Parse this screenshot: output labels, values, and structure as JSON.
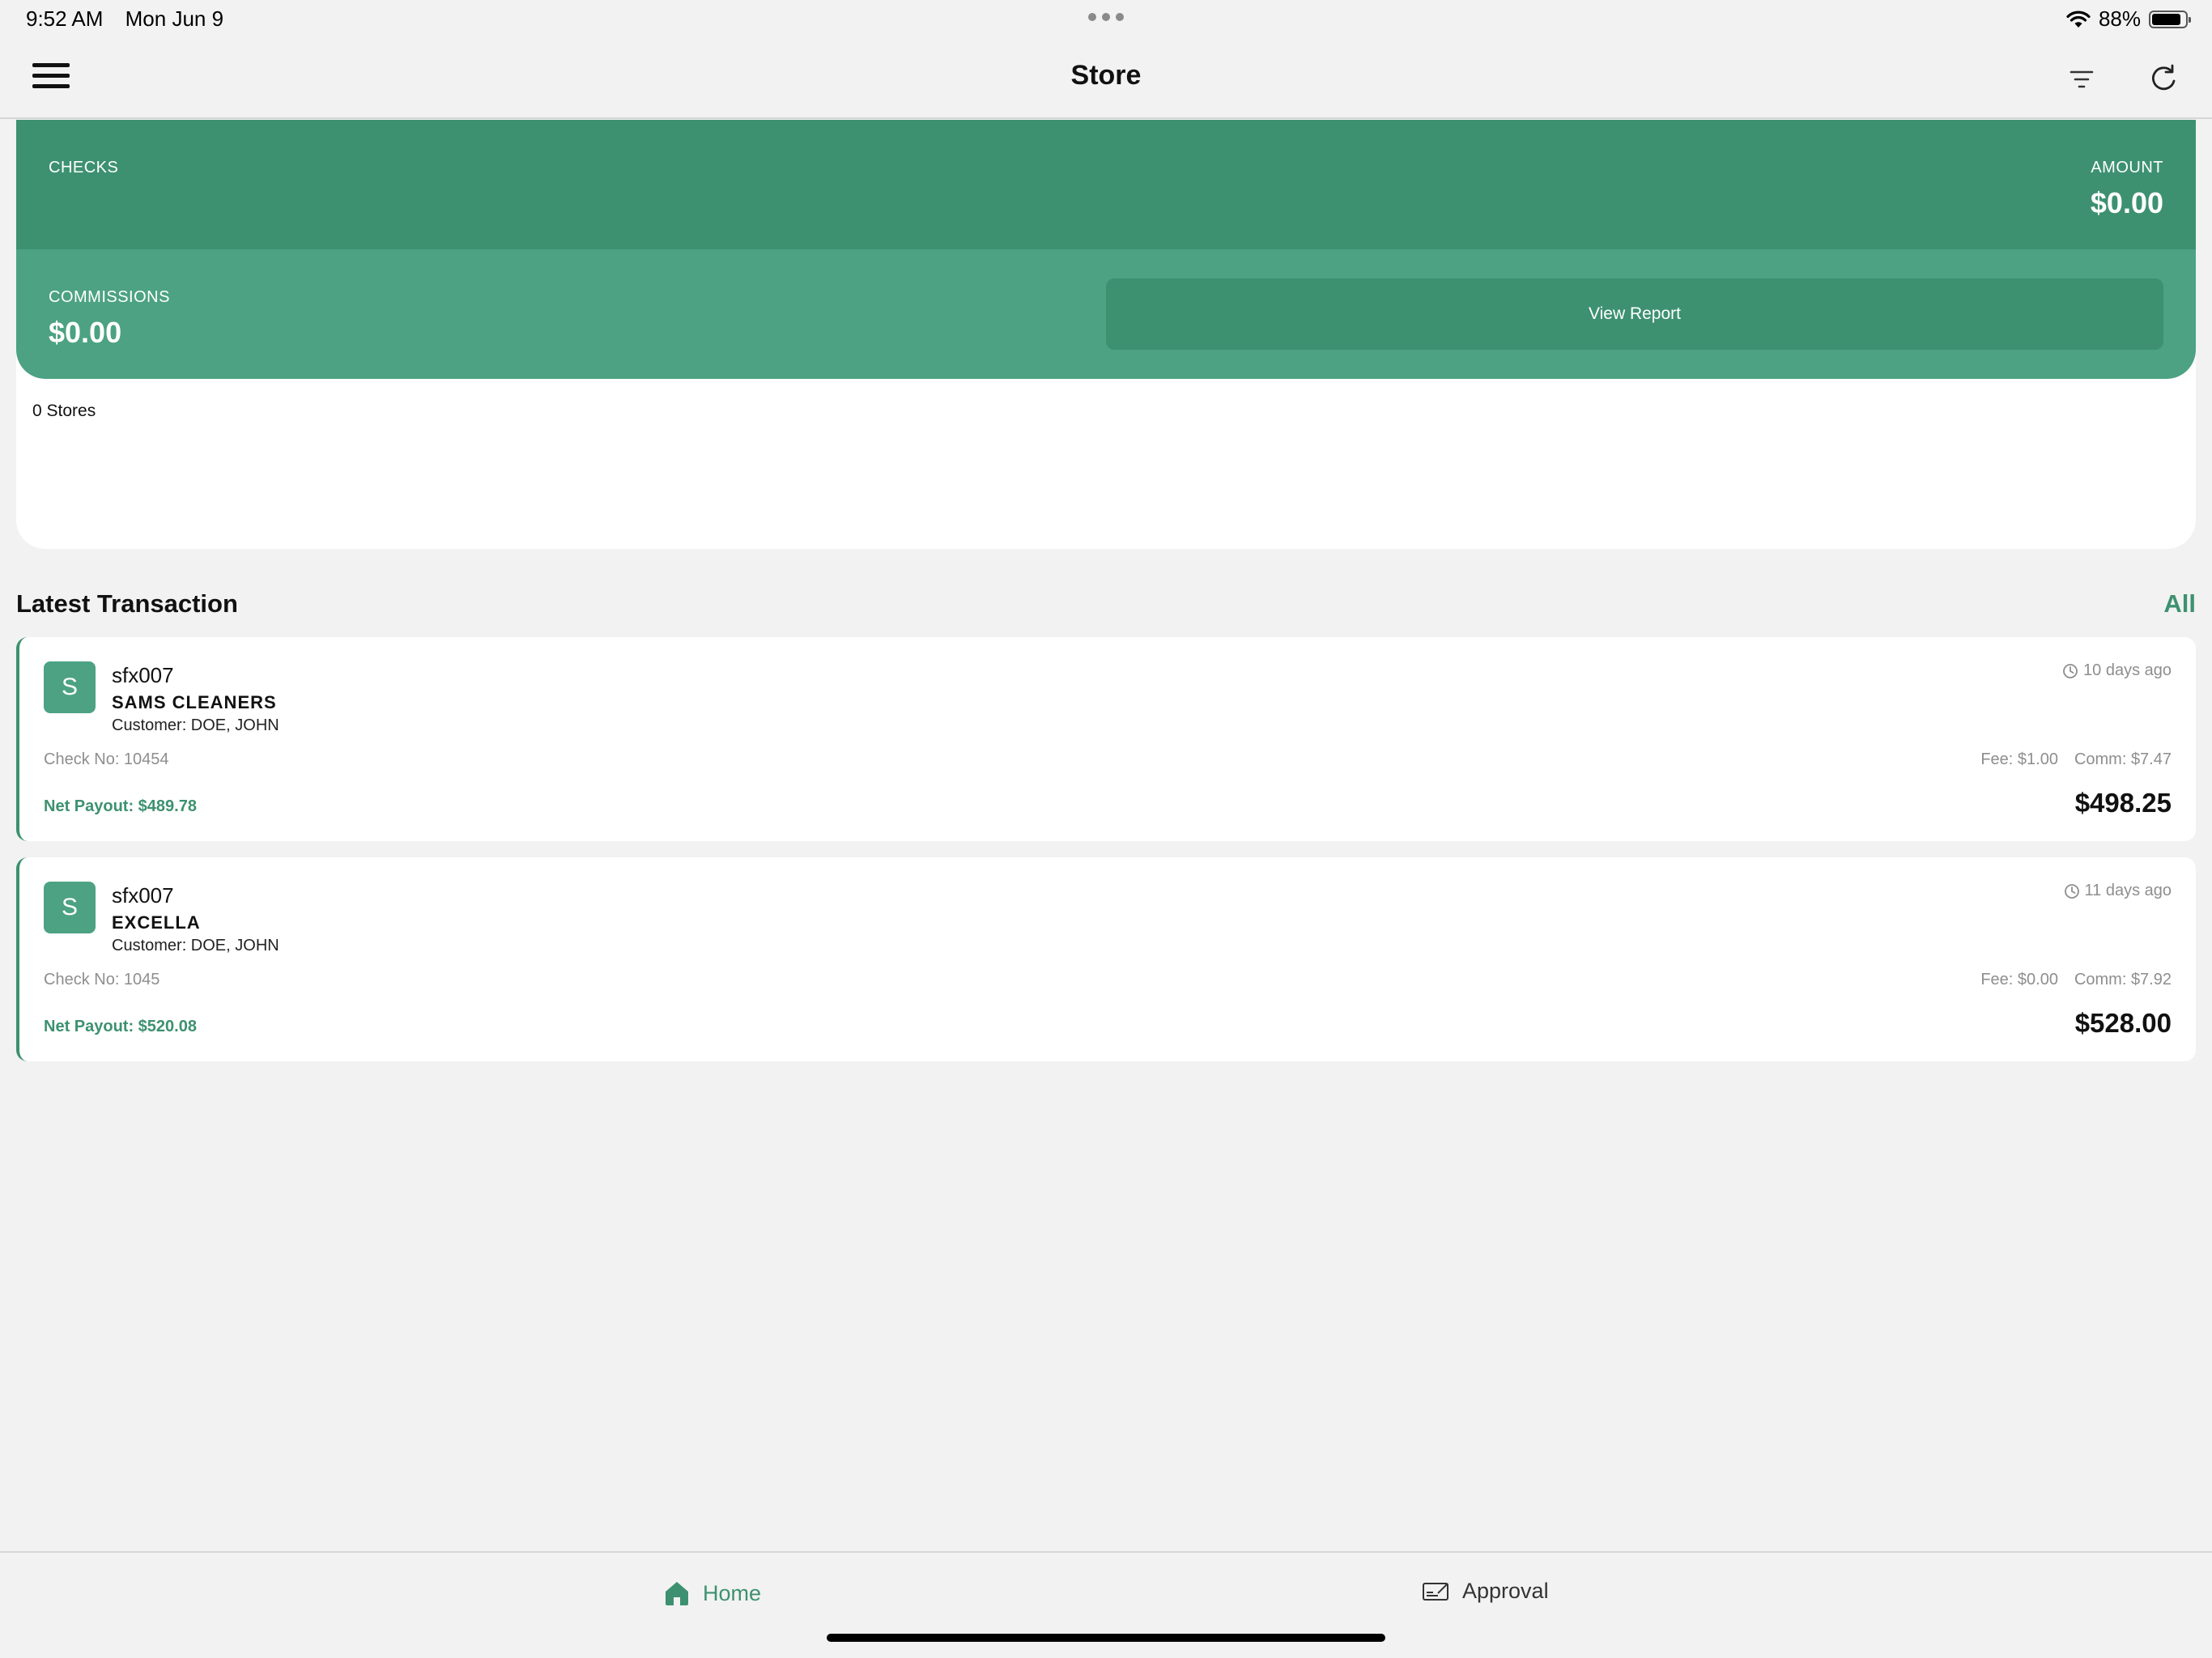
{
  "status_bar": {
    "time": "9:52 AM",
    "date": "Mon Jun 9",
    "battery_percent": "88%",
    "battery_level": 0.88
  },
  "nav": {
    "title": "Store",
    "menu_icon": "hamburger-menu-icon",
    "filter_icon": "filter-icon",
    "refresh_icon": "refresh-icon"
  },
  "summary": {
    "checks_label": "CHECKS",
    "amount_label": "AMOUNT",
    "amount_value": "$0.00",
    "commissions_label": "COMMISSIONS",
    "commissions_value": "$0.00",
    "view_report_label": "View Report",
    "stores_count": "0 Stores"
  },
  "latest": {
    "title": "Latest Transaction",
    "all_label": "All"
  },
  "transactions": [
    {
      "avatar": "S",
      "id": "sfx007",
      "store": "SAMS CLEANERS",
      "customer": "Customer: DOE, JOHN",
      "check_no": "Check No: 10454",
      "net_payout": "Net Payout: $489.78",
      "time_ago": "10 days ago",
      "fee": "Fee: $1.00",
      "comm": "Comm: $7.47",
      "amount": "$498.25"
    },
    {
      "avatar": "S",
      "id": "sfx007",
      "store": "EXCELLA",
      "customer": "Customer: DOE, JOHN",
      "check_no": "Check No: 1045",
      "net_payout": "Net Payout: $520.08",
      "time_ago": "11 days ago",
      "fee": "Fee: $0.00",
      "comm": "Comm: $7.92",
      "amount": "$528.00"
    }
  ],
  "tabs": {
    "home_label": "Home",
    "approval_label": "Approval"
  },
  "colors": {
    "primary": "#3d9170",
    "primary_light": "#4ca283",
    "background": "#f2f2f2"
  }
}
